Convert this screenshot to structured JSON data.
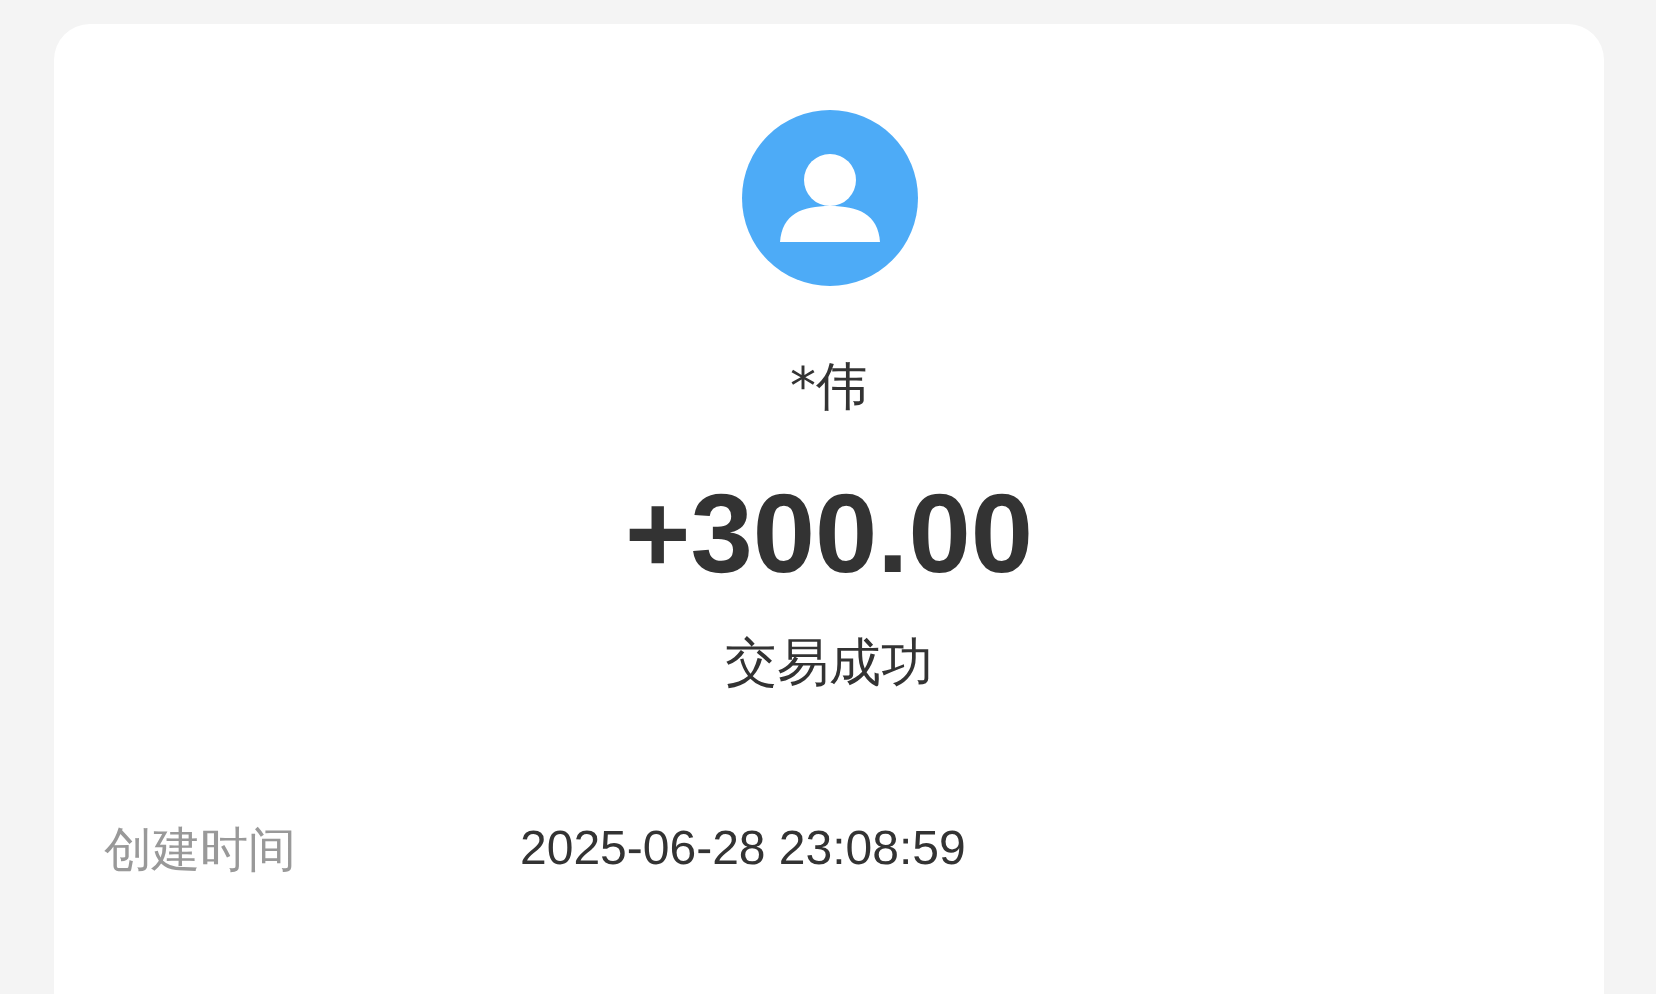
{
  "payee": {
    "name": "*伟"
  },
  "amount": "+300.00",
  "status": "交易成功",
  "details": [
    {
      "label": "创建时间",
      "value": "2025-06-28 23:08:59"
    }
  ]
}
